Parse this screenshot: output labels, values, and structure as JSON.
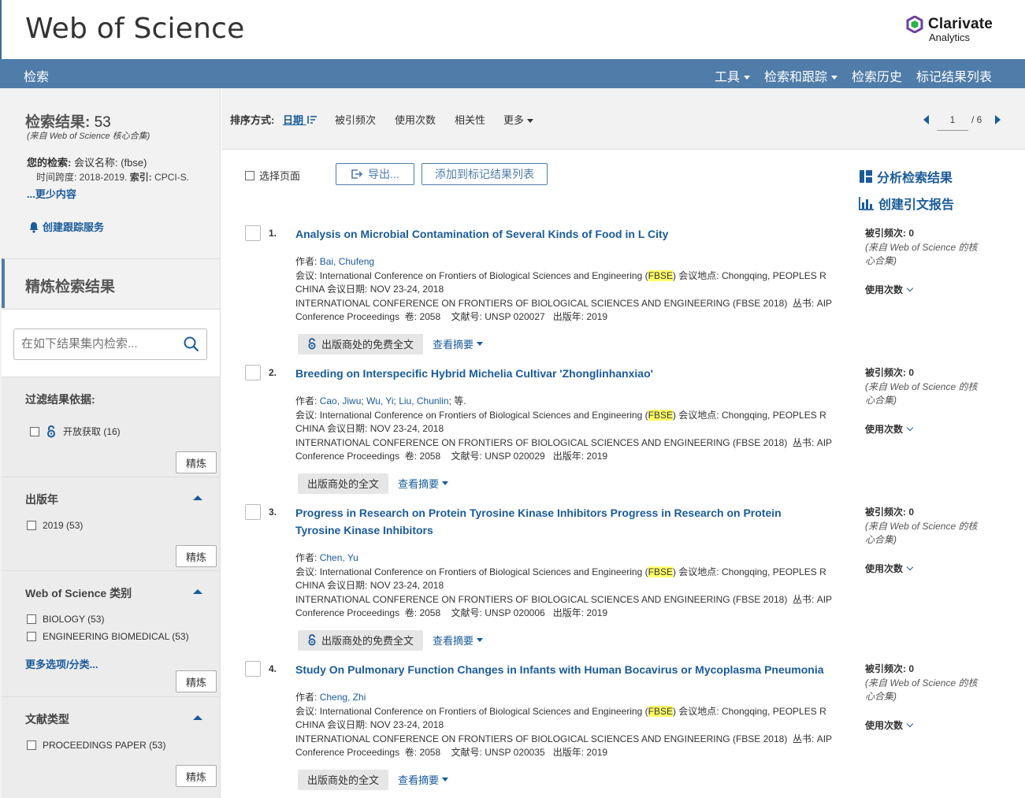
{
  "header": {
    "brand": "Web of Science",
    "vendor_name": "Clarivate",
    "vendor_sub": "Analytics"
  },
  "nav": {
    "search": "检索",
    "items": [
      {
        "label": "工具",
        "dropdown": true
      },
      {
        "label": "检索和跟踪",
        "dropdown": true
      },
      {
        "label": "检索历史",
        "dropdown": false
      },
      {
        "label": "标记结果列表",
        "dropdown": false
      }
    ]
  },
  "summary": {
    "results_label": "检索结果:",
    "results_count": "53",
    "source": "(来自 Web of Science 核心合集)",
    "query_label": "您的检索:",
    "query_text": "会议名称: (fbse)",
    "query_detail_1": "时间跨度: 2018-2019.",
    "query_detail_2_label": "索引:",
    "query_detail_2": "CPCI-S.",
    "less_link": "...更少内容",
    "alert_link": "创建跟踪服务"
  },
  "refine": {
    "title": "精炼检索结果",
    "search_placeholder": "在如下结果集内检索...",
    "refine_label": "精炼",
    "more_options": "更多选项/分类...",
    "facets": [
      {
        "title": "过滤结果依据:",
        "options": [
          "开放获取 (16)"
        ]
      },
      {
        "title": "出版年",
        "options": [
          "2019 (53)"
        ]
      },
      {
        "title": "Web of Science 类别",
        "options": [
          "BIOLOGY (53)",
          "ENGINEERING BIOMEDICAL (53)"
        ]
      },
      {
        "title": "文献类型",
        "options": [
          "PROCEEDINGS PAPER (53)"
        ]
      }
    ]
  },
  "sort": {
    "label": "排序方式:",
    "options": [
      "日期",
      "被引频次",
      "使用次数",
      "相关性",
      "更多"
    ],
    "active": "日期"
  },
  "pager": {
    "current": "1",
    "total": "/ 6"
  },
  "toolbar": {
    "select_page": "选择页面",
    "export": "导出...",
    "add_to_marked": "添加到标记结果列表"
  },
  "analysis": {
    "analyze": "分析检索结果",
    "citation_report": "创建引文报告"
  },
  "labels": {
    "authors": "作者:",
    "conference": "会议:",
    "location": "会议地点:",
    "date": "会议日期:",
    "series": "丛书:",
    "volume": "卷:",
    "article_no": "文献号:",
    "pub_year": "出版年:",
    "times_cited": "被引频次:",
    "cite_source": "(来自 Web of Science 的核心合集)",
    "usage": "使用次数",
    "view_abstract": "查看摘要"
  },
  "records": [
    {
      "num": "1.",
      "title": "Analysis on Microbial Contamination of Several Kinds of Food in L City",
      "authors": [
        "Bai, Chufeng"
      ],
      "authors_suffix": "",
      "conf_pre": "International Conference on Frontiers of Biological Sciences and Engineering (",
      "conf_hl": "FBSE",
      "conf_post": ")",
      "location": "Chongqing, PEOPLES R CHINA",
      "date": "NOV 23-24, 2018",
      "series": "INTERNATIONAL CONFERENCE ON FRONTIERS OF BIOLOGICAL SCIENCES AND ENGINEERING (FBSE 2018)",
      "series_book": "AIP Conference Proceedings",
      "volume": "2058",
      "article_no": "UNSP 020027",
      "pub_year": "2019",
      "fulltext": "出版商处的免费全文",
      "open_access": true,
      "times_cited": "0"
    },
    {
      "num": "2.",
      "title": "Breeding on Interspecific Hybrid Michelia Cultivar 'Zhonglinhanxiao'",
      "authors": [
        "Cao, Jiwu",
        "Wu, Yi",
        "Liu, Chunlin"
      ],
      "authors_suffix": "; 等.",
      "conf_pre": "International Conference on Frontiers of Biological Sciences and Engineering (",
      "conf_hl": "FBSE",
      "conf_post": ")",
      "location": "Chongqing, PEOPLES R CHINA",
      "date": "NOV 23-24, 2018",
      "series": "INTERNATIONAL CONFERENCE ON FRONTIERS OF BIOLOGICAL SCIENCES AND ENGINEERING (FBSE 2018)",
      "series_book": "AIP Conference Proceedings",
      "volume": "2058",
      "article_no": "UNSP 020029",
      "pub_year": "2019",
      "fulltext": "出版商处的全文",
      "open_access": false,
      "times_cited": "0"
    },
    {
      "num": "3.",
      "title": "Progress in Research on Protein Tyrosine Kinase Inhibitors Progress in Research on Protein Tyrosine Kinase Inhibitors",
      "authors": [
        "Chen, Yu"
      ],
      "authors_suffix": "",
      "conf_pre": "International Conference on Frontiers of Biological Sciences and Engineering (",
      "conf_hl": "FBSE",
      "conf_post": ")",
      "location": "Chongqing, PEOPLES R CHINA",
      "date": "NOV 23-24, 2018",
      "series": "INTERNATIONAL CONFERENCE ON FRONTIERS OF BIOLOGICAL SCIENCES AND ENGINEERING (FBSE 2018)",
      "series_book": "AIP Conference Proceedings",
      "volume": "2058",
      "article_no": "UNSP 020006",
      "pub_year": "2019",
      "fulltext": "出版商处的免费全文",
      "open_access": true,
      "times_cited": "0"
    },
    {
      "num": "4.",
      "title": "Study On Pulmonary Function Changes in Infants with Human Bocavirus or Mycoplasma Pneumonia",
      "authors": [
        "Cheng, Zhi"
      ],
      "authors_suffix": "",
      "conf_pre": "International Conference on Frontiers of Biological Sciences and Engineering (",
      "conf_hl": "FBSE",
      "conf_post": ")",
      "location": "Chongqing, PEOPLES R CHINA",
      "date": "NOV 23-24, 2018",
      "series": "INTERNATIONAL CONFERENCE ON FRONTIERS OF BIOLOGICAL SCIENCES AND ENGINEERING (FBSE 2018)",
      "series_book": "AIP Conference Proceedings",
      "volume": "2058",
      "article_no": "UNSP 020035",
      "pub_year": "2019",
      "fulltext": "出版商处的全文",
      "open_access": false,
      "times_cited": "0"
    }
  ],
  "colors": {
    "nav_bg": "#4f7ca8",
    "link": "#1a5b9a",
    "highlight": "#ffff66"
  }
}
